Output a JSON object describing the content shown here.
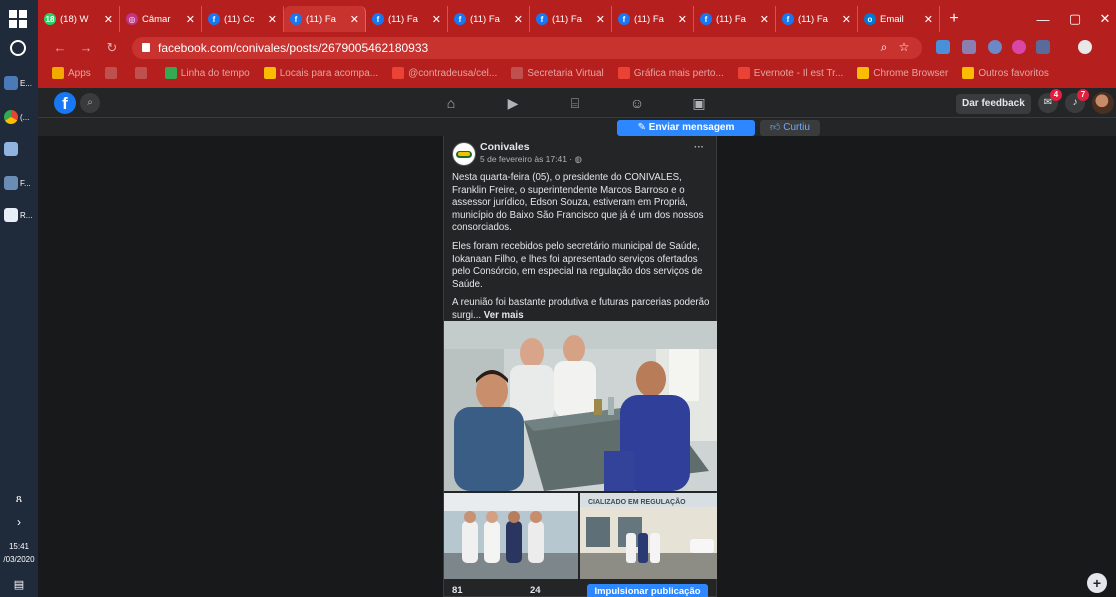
{
  "taskbar": {
    "apps": [
      {
        "label": "E..."
      },
      {
        "label": "(..."
      },
      {
        "label": ""
      },
      {
        "label": "F..."
      },
      {
        "label": "R..."
      }
    ],
    "time": "15:41",
    "date": "/03/2020"
  },
  "browser": {
    "tabs": [
      {
        "label": "(18) W",
        "fav_text": "18",
        "fav_color": "#25d366"
      },
      {
        "label": "Câmar",
        "fav_text": "◎",
        "fav_color": "#c13584"
      },
      {
        "label": "(11) Cc",
        "fav_text": "f",
        "fav_color": "#1877f2"
      },
      {
        "label": "(11) Fa",
        "fav_text": "f",
        "fav_color": "#1877f2"
      },
      {
        "label": "(11) Fa",
        "fav_text": "f",
        "fav_color": "#1877f2"
      },
      {
        "label": "(11) Fa",
        "fav_text": "f",
        "fav_color": "#1877f2"
      },
      {
        "label": "(11) Fa",
        "fav_text": "f",
        "fav_color": "#1877f2"
      },
      {
        "label": "(11) Fa",
        "fav_text": "f",
        "fav_color": "#1877f2"
      },
      {
        "label": "(11) Fa",
        "fav_text": "f",
        "fav_color": "#1877f2"
      },
      {
        "label": "(11) Fa",
        "fav_text": "f",
        "fav_color": "#1877f2"
      },
      {
        "label": "Email",
        "fav_text": "o",
        "fav_color": "#0078d4"
      }
    ],
    "url": "facebook.com/conivales/posts/2679005462180933",
    "bookmarks": [
      {
        "label": "Apps",
        "color": "#f2a900"
      },
      {
        "label": "",
        "color": "#c0504d"
      },
      {
        "label": "",
        "color": "#c0504d"
      },
      {
        "label": "Linha do tempo",
        "color": "#34a853"
      },
      {
        "label": "Locais para acompa...",
        "color": "#fbbc04"
      },
      {
        "label": "@contradeusa/cel...",
        "color": "#ea4335"
      },
      {
        "label": "Secretaria Virtual",
        "color": "#c0504d"
      },
      {
        "label": "Gráfica mais perto...",
        "color": "#ea4335"
      },
      {
        "label": "Evernote - Il est Tr...",
        "color": "#ea4335"
      },
      {
        "label": "Chrome Browser",
        "color": "#fbbc04"
      },
      {
        "label": "Outros favoritos",
        "color": "#fbbc04"
      }
    ]
  },
  "fb_header": {
    "feedback_label": "Dar feedback",
    "messages_badge": "4",
    "notifications_badge": "7"
  },
  "page_actions": {
    "send_message": "Enviar mensagem",
    "liked": "Curtiu"
  },
  "post": {
    "author": "Conivales",
    "date": "5 de fevereiro às 17:41 · ",
    "paragraphs": [
      "Nesta quarta-feira (05), o presidente do CONIVALES, Franklin Freire, o superintendente Marcos Barroso e o assessor jurídico, Edson Souza, estiveram em Propriá, município do Baixo São Francisco que já é um dos nossos consorciados.",
      "Eles foram recebidos pelo secretário municipal de Saúde, Iokanaan Filho, e lhes foi apresentado  serviços ofertados pelo Consórcio, em especial na regulação dos serviços de Saúde."
    ],
    "last_paragraph": "A reunião foi bastante produtiva e futuras parcerias poderão surgi... ",
    "see_more": "Ver mais",
    "sign_text": "CIALIZADO EM REGULAÇÃO",
    "reactions_count": "81",
    "comments_count": "24",
    "boost_label": "Impulsionar publicação"
  }
}
